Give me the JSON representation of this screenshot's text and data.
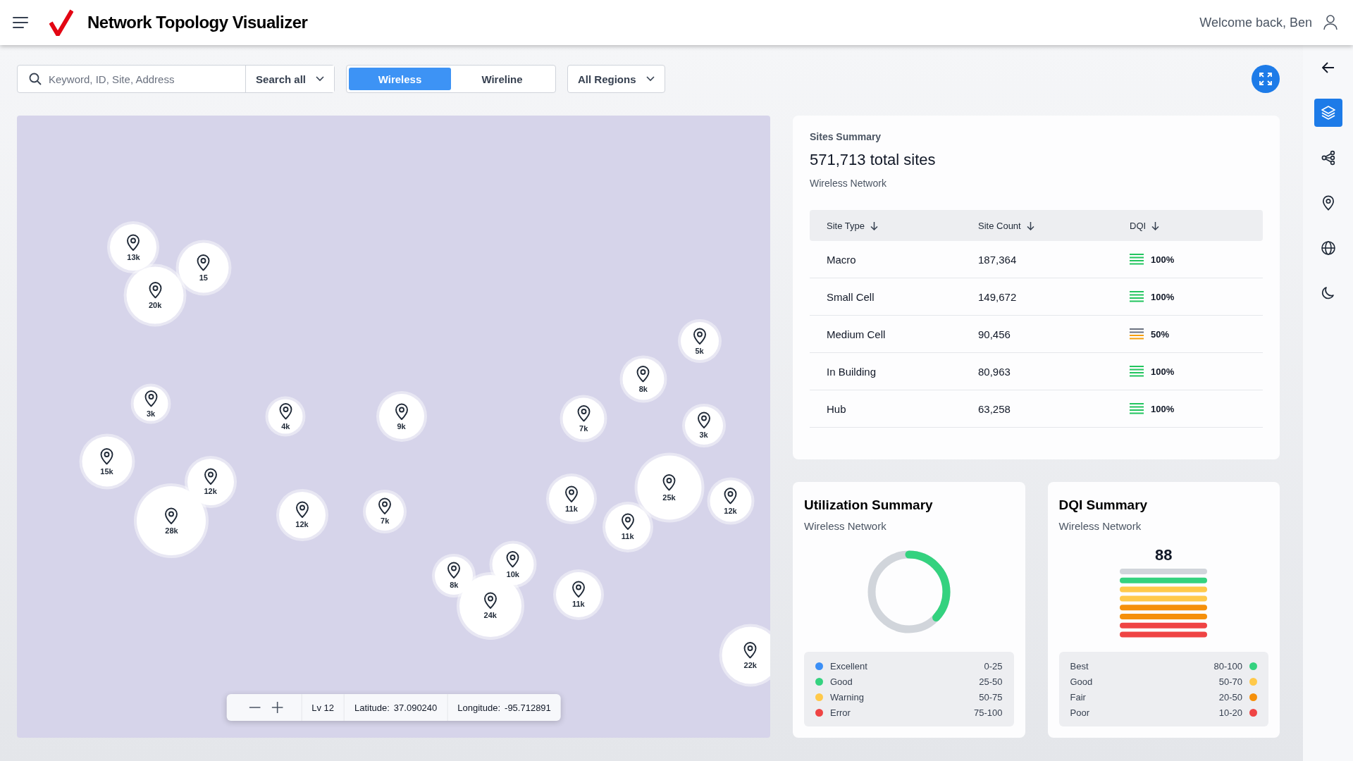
{
  "header": {
    "title": "Network Topology Visualizer",
    "welcome": "Welcome back, Ben"
  },
  "search": {
    "placeholder": "Keyword, ID, Site, Address",
    "scope": "Search all"
  },
  "network_tabs": [
    {
      "label": "Wireless",
      "selected": true
    },
    {
      "label": "Wireline",
      "selected": false
    }
  ],
  "region_filter": "All Regions",
  "map": {
    "clusters": [
      {
        "count": "13k"
      },
      {
        "count": "15"
      },
      {
        "count": "20k"
      },
      {
        "count": "3k"
      },
      {
        "count": "4k"
      },
      {
        "count": "9k"
      },
      {
        "count": "7k"
      },
      {
        "count": "8k"
      },
      {
        "count": "5k"
      },
      {
        "count": "3k"
      },
      {
        "count": "15k"
      },
      {
        "count": "12k"
      },
      {
        "count": "28k"
      },
      {
        "count": "12k"
      },
      {
        "count": "7k"
      },
      {
        "count": "11k"
      },
      {
        "count": "25k"
      },
      {
        "count": "12k"
      },
      {
        "count": "11k"
      },
      {
        "count": "10k"
      },
      {
        "count": "8k"
      },
      {
        "count": "24k"
      },
      {
        "count": "11k"
      },
      {
        "count": "22k"
      }
    ],
    "zoom_level": "Lv 12",
    "latitude_label": "Latitude:",
    "latitude": "37.090240",
    "longitude_label": "Longitude:",
    "longitude": "-95.712891"
  },
  "sites_summary": {
    "title": "Sites Summary",
    "total": "571,713 total sites",
    "subtitle": "Wireless Network",
    "columns": [
      "Site Type",
      "Site Count",
      "DQI"
    ],
    "rows": [
      {
        "site_type": "Macro",
        "site_count": "187,364",
        "dqi": "100%",
        "kind": "full",
        "color": "#22c55e"
      },
      {
        "site_type": "Small Cell",
        "site_count": "149,672",
        "dqi": "100%",
        "kind": "full",
        "color": "#22c55e"
      },
      {
        "site_type": "Medium Cell",
        "site_count": "90,456",
        "dqi": "50%",
        "kind": "half",
        "color": "#f59e0b"
      },
      {
        "site_type": "In Building",
        "site_count": "80,963",
        "dqi": "100%",
        "kind": "full",
        "color": "#22c55e"
      },
      {
        "site_type": "Hub",
        "site_count": "63,258",
        "dqi": "100%",
        "kind": "full",
        "color": "#22c55e"
      }
    ]
  },
  "utilization_summary": {
    "title": "Utilization Summary",
    "subtitle": "Wireless Network",
    "level": 0.37,
    "legend": [
      {
        "label": "Excellent",
        "range": "0-25",
        "color": "#3b8ff6"
      },
      {
        "label": "Good",
        "range": "25-50",
        "color": "#34d27f"
      },
      {
        "label": "Warning",
        "range": "50-75",
        "color": "#ffc94a"
      },
      {
        "label": "Error",
        "range": "75-100",
        "color": "#ef4444"
      }
    ]
  },
  "dqi_summary": {
    "title": "DQI Summary",
    "subtitle": "Wireless Network",
    "score": "88",
    "legend": [
      {
        "label": "Best",
        "range": "80-100",
        "color": "#34d27f"
      },
      {
        "label": "Good",
        "range": "50-70",
        "color": "#ffc94a"
      },
      {
        "label": "Fair",
        "range": "20-50",
        "color": "#f5900b"
      },
      {
        "label": "Poor",
        "range": "10-20",
        "color": "#ef4444"
      }
    ]
  },
  "tool_rail": [
    {
      "kind": "layers",
      "selected": true
    },
    {
      "kind": "network",
      "selected": false
    },
    {
      "kind": "pin",
      "selected": false
    },
    {
      "kind": "globe",
      "selected": false
    },
    {
      "kind": "moon",
      "selected": false
    }
  ]
}
